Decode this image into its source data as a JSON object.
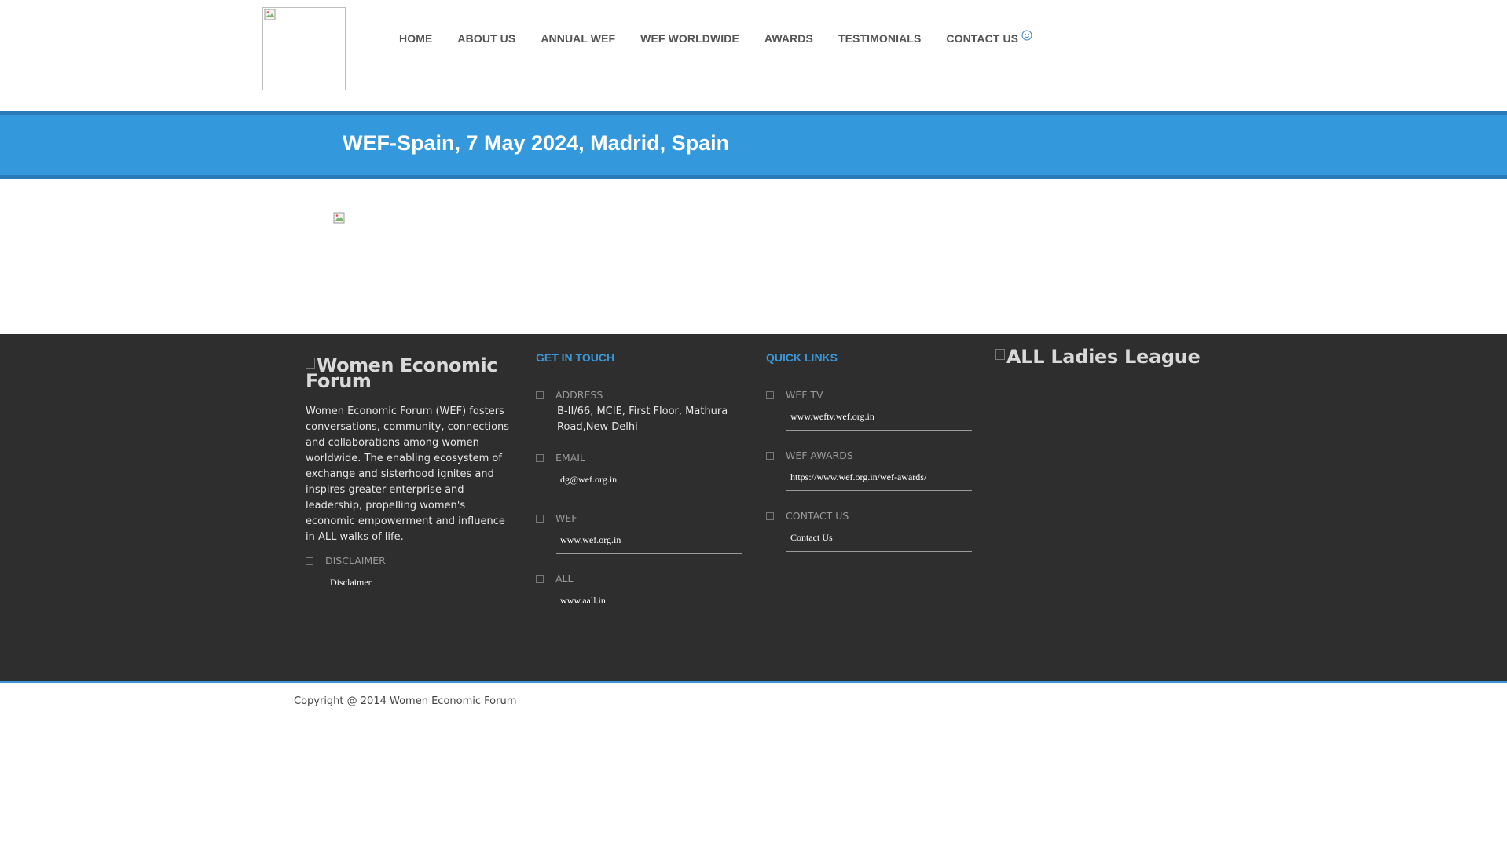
{
  "nav": {
    "items": [
      "HOME",
      "ABOUT US",
      "ANNUAL WEF",
      "WEF WORLDWIDE",
      "AWARDS",
      "TESTIMONIALS",
      "CONTACT US"
    ]
  },
  "banner": {
    "title": "WEF-Spain, 7 May 2024, Madrid, Spain"
  },
  "footer": {
    "brand_alt_line1": "Women Economic",
    "brand_alt_line2": "Forum",
    "about_text": "Women Economic Forum (WEF) fosters conversations, community, connections and collaborations among women worldwide. The enabling ecosystem of exchange and sisterhood ignites and inspires greater enterprise and leadership, propelling women's economic empowerment and influence in ALL walks of life.",
    "disclaimer": {
      "label": "DISCLAIMER",
      "link": "Disclaimer"
    },
    "get_in_touch": {
      "heading": "GET IN TOUCH",
      "address": {
        "label": "ADDRESS",
        "text": "B-II/66, MCIE, First Floor, Mathura Road,New Delhi"
      },
      "email": {
        "label": "EMAIL",
        "link": "dg@wef.org.in"
      },
      "wef": {
        "label": "WEF",
        "link": "www.wef.org.in"
      },
      "all": {
        "label": "ALL",
        "link": "www.aall.in"
      }
    },
    "quick_links": {
      "heading": "QUICK LINKS",
      "wef_tv": {
        "label": "WEF TV",
        "link": "www.weftv.wef.org.in"
      },
      "wef_awards": {
        "label": "WEF AWARDS",
        "link": "https://www.wef.org.in/wef-awards/"
      },
      "contact_us": {
        "label": "CONTACT US",
        "link": "Contact Us"
      }
    },
    "league_alt": "ALL Ladies League"
  },
  "copyright": "Copyright @ 2014 Women Economic Forum",
  "colors": {
    "band": "#3398dc",
    "band_border": "#2a79b8",
    "footer_bg": "#2e2e2e",
    "accent": "#3a97d8"
  }
}
